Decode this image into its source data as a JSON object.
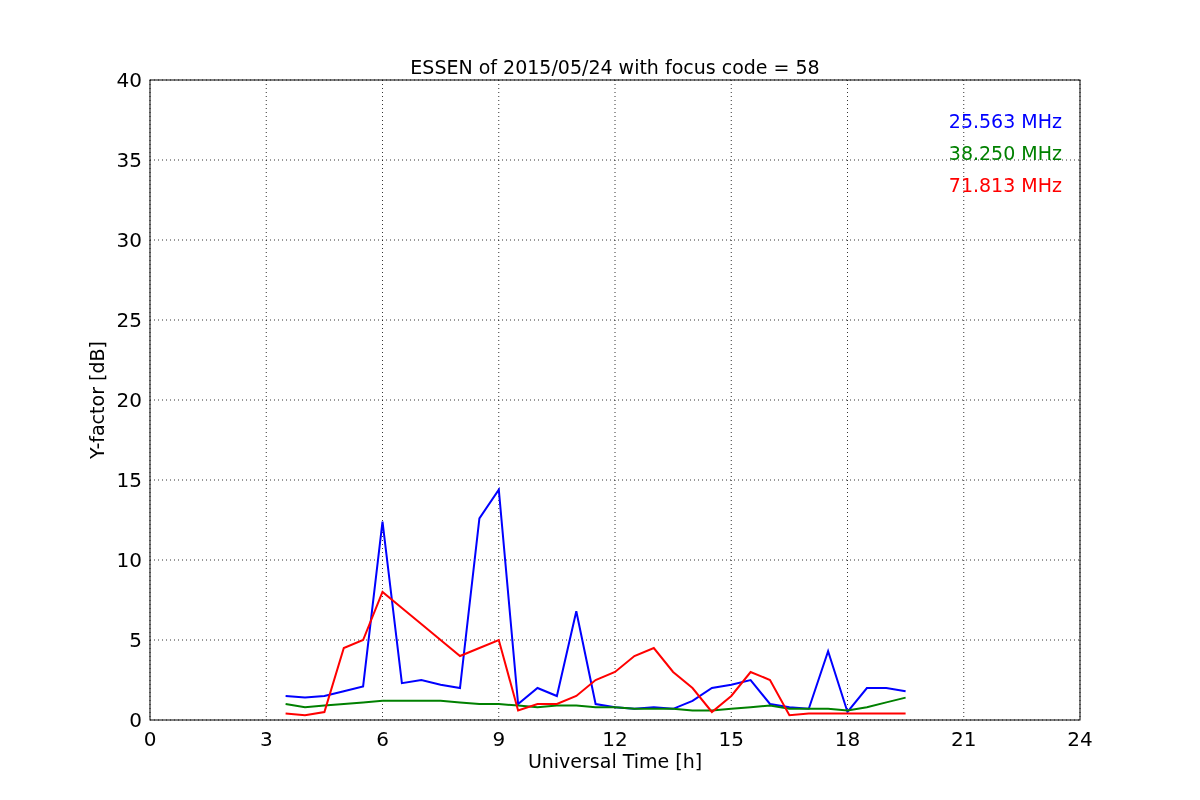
{
  "chart_data": {
    "type": "line",
    "title": "ESSEN of 2015/05/24 with focus code = 58",
    "xlabel": "Universal Time [h]",
    "ylabel": "Y-factor [dB]",
    "x": [
      3.5,
      4,
      4.5,
      5,
      5.5,
      6,
      6.5,
      7,
      7.5,
      8,
      8.5,
      9,
      9.5,
      10,
      10.5,
      11,
      11.5,
      12,
      12.5,
      13,
      13.5,
      14,
      14.5,
      15,
      15.5,
      16,
      16.5,
      17,
      17.5,
      18,
      18.5,
      19,
      19.5
    ],
    "series": [
      {
        "name": "25.563 MHz",
        "color": "#0000ff",
        "values": [
          1.5,
          1.4,
          1.5,
          1.8,
          2.1,
          12.4,
          2.3,
          2.5,
          2.2,
          2.0,
          12.6,
          14.4,
          1.0,
          2.0,
          1.5,
          6.8,
          1.0,
          0.8,
          0.7,
          0.8,
          0.7,
          1.2,
          2.0,
          2.2,
          2.5,
          1.0,
          0.8,
          0.7,
          4.3,
          0.5,
          2.0,
          2.0,
          1.8
        ]
      },
      {
        "name": "38.250 MHz",
        "color": "#008000",
        "values": [
          1.0,
          0.8,
          0.9,
          1.0,
          1.1,
          1.2,
          1.2,
          1.2,
          1.2,
          1.1,
          1.0,
          1.0,
          0.9,
          0.8,
          0.9,
          0.9,
          0.8,
          0.8,
          0.7,
          0.7,
          0.7,
          0.6,
          0.6,
          0.7,
          0.8,
          0.9,
          0.7,
          0.7,
          0.7,
          0.6,
          0.8,
          1.1,
          1.4
        ]
      },
      {
        "name": "71.813 MHz",
        "color": "#ff0000",
        "values": [
          0.4,
          0.3,
          0.5,
          4.5,
          5.0,
          8.0,
          7.0,
          6.0,
          5.0,
          4.0,
          4.5,
          5.0,
          0.6,
          1.0,
          1.0,
          1.5,
          2.5,
          3.0,
          4.0,
          4.5,
          3.0,
          2.0,
          0.5,
          1.5,
          3.0,
          2.5,
          0.3,
          0.4,
          0.4,
          0.4,
          0.4,
          0.4,
          0.4
        ]
      }
    ],
    "grid": true,
    "xlim": [
      0,
      24
    ],
    "ylim": [
      0,
      40
    ],
    "xticks": [
      0,
      3,
      6,
      9,
      12,
      15,
      18,
      21,
      24
    ],
    "yticks": [
      0,
      5,
      10,
      15,
      20,
      25,
      30,
      35,
      40
    ]
  }
}
